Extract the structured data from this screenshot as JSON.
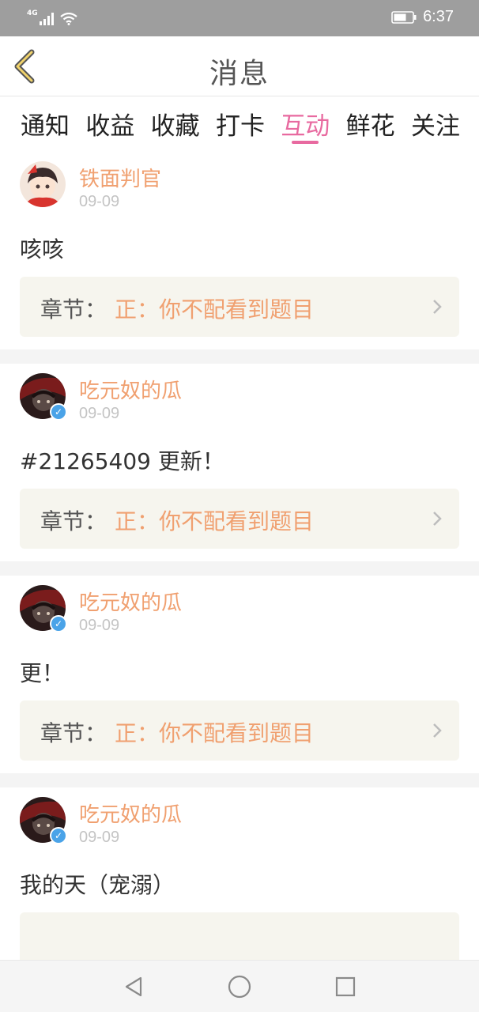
{
  "status_bar": {
    "network": "4G",
    "time": "6:37"
  },
  "header": {
    "title": "消息"
  },
  "tabs": [
    {
      "label": "通知",
      "active": false
    },
    {
      "label": "收益",
      "active": false
    },
    {
      "label": "收藏",
      "active": false
    },
    {
      "label": "打卡",
      "active": false
    },
    {
      "label": "互动",
      "active": true
    },
    {
      "label": "鲜花",
      "active": false
    },
    {
      "label": "关注",
      "active": false
    }
  ],
  "feed": {
    "items": [
      {
        "username": "铁面判官",
        "date": "09-09",
        "content": "咳咳",
        "chapter_label": "章节：",
        "chapter_title": "正：你不配看到题目",
        "verified": false
      },
      {
        "username": "吃元奴的瓜",
        "date": "09-09",
        "content": "#21265409 更新！",
        "chapter_label": "章节：",
        "chapter_title": "正：你不配看到题目",
        "verified": true
      },
      {
        "username": "吃元奴的瓜",
        "date": "09-09",
        "content": "更！",
        "chapter_label": "章节：",
        "chapter_title": "正：你不配看到题目",
        "verified": true
      },
      {
        "username": "吃元奴的瓜",
        "date": "09-09",
        "content": "我的天（宠溺）",
        "verified": true
      }
    ]
  },
  "colors": {
    "accent_pink": "#e86aa0",
    "username_orange": "#f0a070",
    "verified_blue": "#4aa3e8",
    "chapter_bg": "#f6f5ee"
  },
  "icons": {
    "back": "chevron-left-icon",
    "chapter_arrow": "chevron-right-icon",
    "nav": [
      "back-triangle-icon",
      "home-circle-icon",
      "recents-square-icon"
    ]
  }
}
